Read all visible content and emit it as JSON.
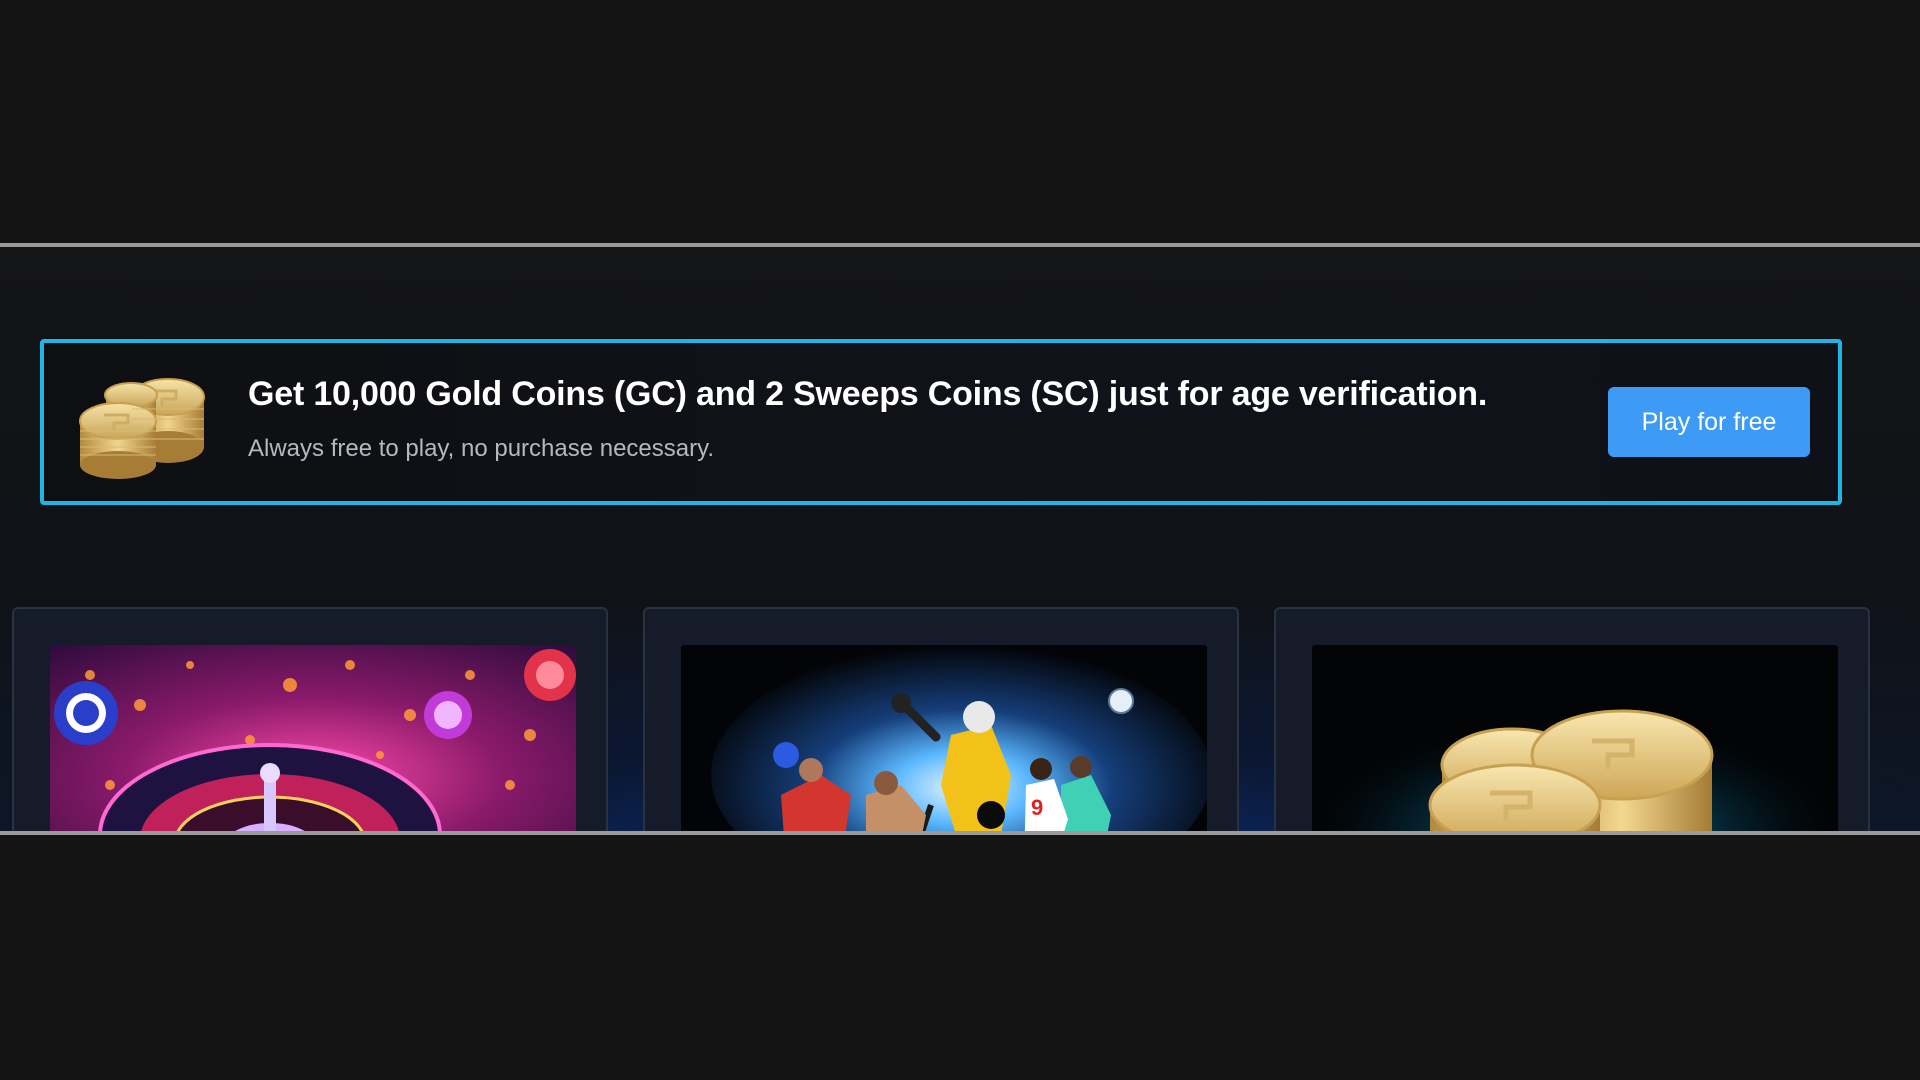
{
  "promo": {
    "title": "Get 10,000 Gold Coins (GC) and 2 Sweeps Coins (SC) just for age verification.",
    "subtitle": "Always free to play, no purchase necessary.",
    "button_label": "Play for free",
    "icon": "gold-coins-stack-icon",
    "border_color": "#1fb6e6",
    "button_color": "#3d9bf5"
  },
  "cards": [
    {
      "name": "casino",
      "image": "roulette-casino-image"
    },
    {
      "name": "sports",
      "image": "athletes-sports-image"
    },
    {
      "name": "coins",
      "image": "gold-coins-image"
    }
  ]
}
